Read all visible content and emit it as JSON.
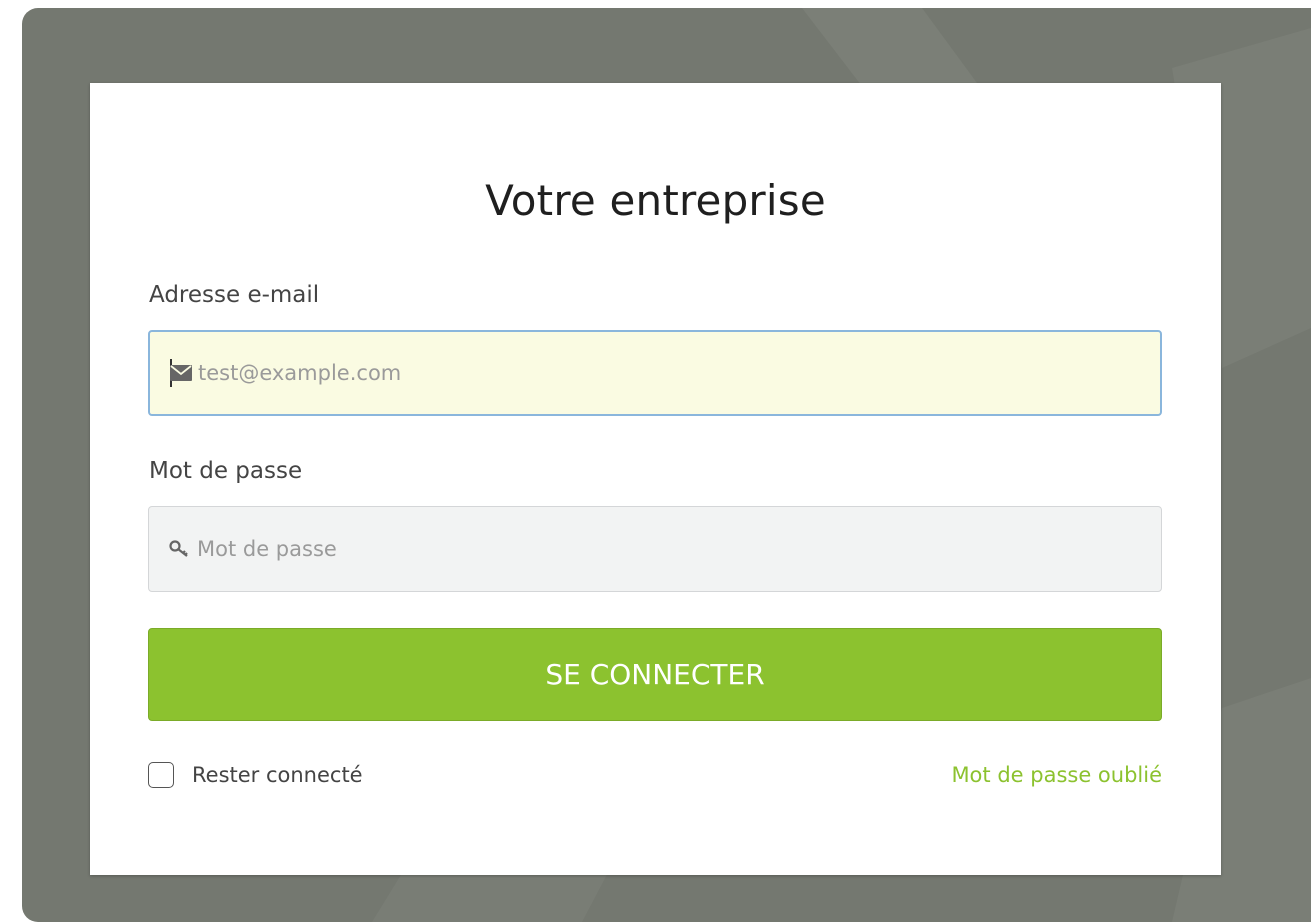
{
  "page": {
    "title": "Votre entreprise"
  },
  "form": {
    "email_label": "Adresse e-mail",
    "email_placeholder": "test@example.com",
    "email_icon": "envelope-icon",
    "password_label": "Mot de passe",
    "password_placeholder": "Mot de passe",
    "password_icon": "key-icon",
    "submit_label": "SE CONNECTER",
    "remember_label": "Rester connecté",
    "remember_checked": false,
    "forgot_label": "Mot de passe oublié"
  },
  "colors": {
    "backdrop": "#747870",
    "accent": "#8cc22f",
    "email_field_bg": "#fafbe2",
    "email_field_border": "#8ab6dc"
  }
}
